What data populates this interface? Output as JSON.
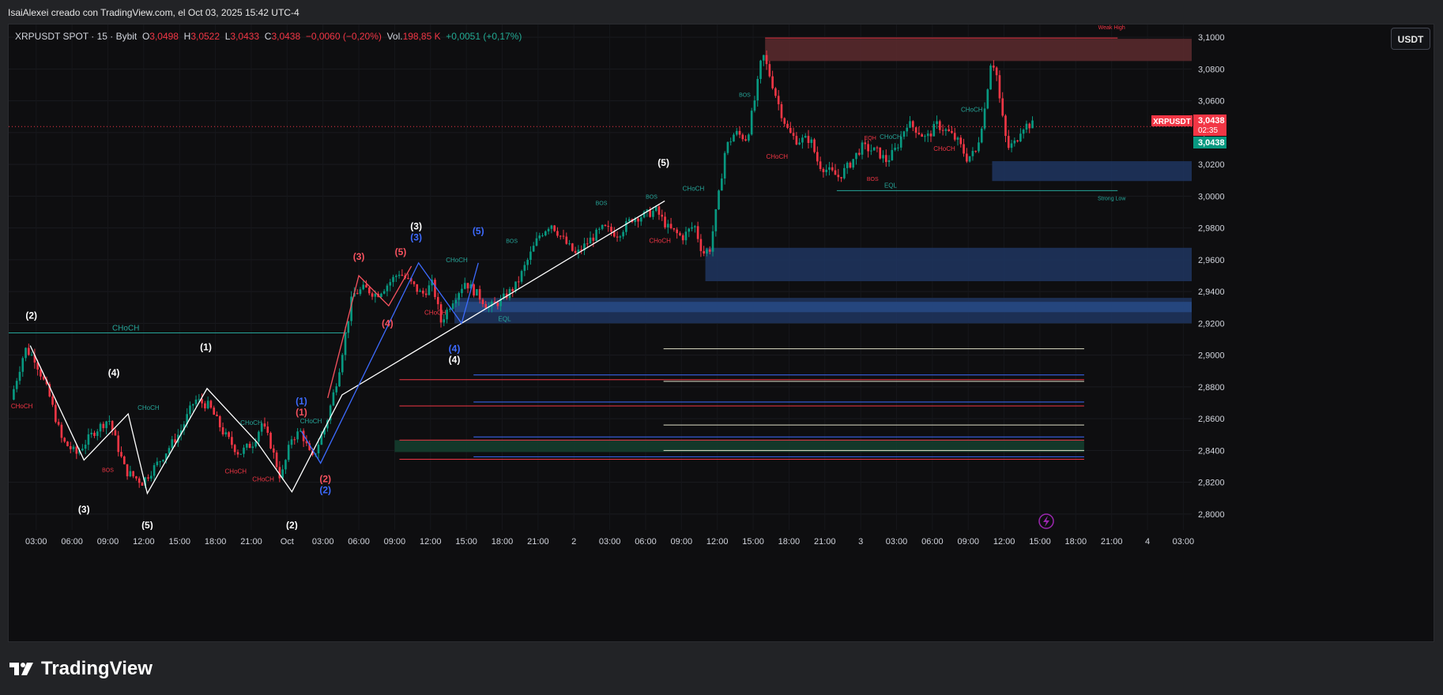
{
  "header": {
    "credit": "IsaiAlexei creado con TradingView.com, el Oct 03, 2025 15:42 UTC-4"
  },
  "legend": {
    "symbol": "XRPUSDT SPOT · 15 · Bybit",
    "o_label": "O",
    "o": "3,0498",
    "h_label": "H",
    "h": "3,0522",
    "l_label": "L",
    "l": "3,0433",
    "c_label": "C",
    "c": "3,0438",
    "change": "−0,0060 (−0,20%)",
    "vol_label": "Vol.",
    "vol": "198,85 K",
    "vol_change": "+0,0051 (+0,17%)"
  },
  "currency_button": "USDT",
  "price_tag": {
    "symbol": "XRPUSDT",
    "price": "3,0438",
    "countdown": "02:35",
    "price2": "3,0438"
  },
  "footer": {
    "brand": "TradingView"
  },
  "colors": {
    "up": "#089981",
    "down": "#f23645",
    "zone_blue": "#1e3560",
    "zone_red": "#5c2a2e",
    "zone_green": "#14402f",
    "teal": "#26a69a",
    "wave_white": "#ffffff",
    "wave_red": "#f7525f",
    "wave_blue": "#3d6bff"
  },
  "chart_data": {
    "type": "candlestick",
    "symbol": "XRPUSDT",
    "timeframe": "15",
    "ylim": [
      2.79,
      3.108
    ],
    "y_ticks": [
      "3,1000",
      "3,0800",
      "3,0600",
      "3,0400",
      "3,0200",
      "3,0000",
      "2,9800",
      "2,9600",
      "2,9400",
      "2,9200",
      "2,9000",
      "2,8800",
      "2,8600",
      "2,8400",
      "2,8200",
      "2,8000"
    ],
    "y_tick_values": [
      3.1,
      3.08,
      3.06,
      3.04,
      3.02,
      3.0,
      2.98,
      2.96,
      2.94,
      2.92,
      2.9,
      2.88,
      2.86,
      2.84,
      2.82,
      2.8
    ],
    "x_ticks": [
      "03:00",
      "06:00",
      "09:00",
      "12:00",
      "15:00",
      "18:00",
      "21:00",
      "Oct",
      "03:00",
      "06:00",
      "09:00",
      "12:00",
      "15:00",
      "18:00",
      "21:00",
      "2",
      "03:00",
      "06:00",
      "09:00",
      "12:00",
      "15:00",
      "18:00",
      "21:00",
      "3",
      "03:00",
      "06:00",
      "09:00",
      "12:00",
      "15:00",
      "18:00",
      "21:00",
      "4",
      "03:00"
    ],
    "x_tick_hours": [
      3,
      6,
      9,
      12,
      15,
      18,
      21,
      24,
      27,
      30,
      33,
      36,
      39,
      42,
      45,
      48,
      51,
      54,
      57,
      60,
      63,
      66,
      69,
      72,
      75,
      78,
      81,
      84,
      87,
      90,
      93,
      96,
      99
    ],
    "x_range_hours": [
      0.7,
      99.7
    ],
    "last_price": 3.0438,
    "price_path": [
      [
        1.0,
        2.872
      ],
      [
        2.2,
        2.904
      ],
      [
        3.0,
        2.898
      ],
      [
        4.2,
        2.875
      ],
      [
        5.3,
        2.846
      ],
      [
        6.5,
        2.838
      ],
      [
        8.0,
        2.852
      ],
      [
        9.2,
        2.86
      ],
      [
        10.6,
        2.827
      ],
      [
        12.0,
        2.82
      ],
      [
        13.5,
        2.834
      ],
      [
        15.2,
        2.852
      ],
      [
        16.4,
        2.872
      ],
      [
        17.6,
        2.868
      ],
      [
        18.8,
        2.851
      ],
      [
        20.1,
        2.838
      ],
      [
        21.3,
        2.845
      ],
      [
        22.0,
        2.857
      ],
      [
        22.7,
        2.845
      ],
      [
        23.6,
        2.822
      ],
      [
        24.5,
        2.848
      ],
      [
        25.3,
        2.852
      ],
      [
        26.2,
        2.834
      ],
      [
        27.4,
        2.857
      ],
      [
        28.4,
        2.888
      ],
      [
        29.6,
        2.938
      ],
      [
        30.6,
        2.942
      ],
      [
        31.6,
        2.938
      ],
      [
        32.6,
        2.945
      ],
      [
        33.5,
        2.952
      ],
      [
        34.5,
        2.945
      ],
      [
        35.4,
        2.938
      ],
      [
        36.3,
        2.945
      ],
      [
        37.0,
        2.921
      ],
      [
        38.0,
        2.935
      ],
      [
        39.0,
        2.946
      ],
      [
        40.2,
        2.937
      ],
      [
        41.0,
        2.93
      ],
      [
        42.0,
        2.934
      ],
      [
        43.3,
        2.944
      ],
      [
        44.4,
        2.962
      ],
      [
        45.2,
        2.975
      ],
      [
        46.2,
        2.983
      ],
      [
        47.5,
        2.97
      ],
      [
        48.3,
        2.963
      ],
      [
        49.4,
        2.972
      ],
      [
        50.6,
        2.98
      ],
      [
        51.8,
        2.976
      ],
      [
        53.0,
        2.986
      ],
      [
        54.0,
        2.988
      ],
      [
        55.0,
        2.991
      ],
      [
        56.0,
        2.98
      ],
      [
        57.2,
        2.974
      ],
      [
        58.2,
        2.982
      ],
      [
        58.9,
        2.964
      ],
      [
        59.5,
        2.967
      ],
      [
        60.2,
        2.998
      ],
      [
        60.8,
        3.03
      ],
      [
        61.6,
        3.04
      ],
      [
        62.6,
        3.036
      ],
      [
        63.4,
        3.066
      ],
      [
        63.9,
        3.09
      ],
      [
        64.6,
        3.074
      ],
      [
        65.4,
        3.054
      ],
      [
        66.1,
        3.04
      ],
      [
        66.8,
        3.035
      ],
      [
        67.9,
        3.036
      ],
      [
        68.6,
        3.02
      ],
      [
        69.4,
        3.016
      ],
      [
        70.3,
        3.012
      ],
      [
        71.2,
        3.02
      ],
      [
        72.2,
        3.031
      ],
      [
        73.5,
        3.028
      ],
      [
        74.3,
        3.022
      ],
      [
        75.1,
        3.03
      ],
      [
        76.0,
        3.046
      ],
      [
        76.8,
        3.042
      ],
      [
        77.6,
        3.036
      ],
      [
        78.5,
        3.045
      ],
      [
        79.5,
        3.04
      ],
      [
        80.3,
        3.034
      ],
      [
        81.0,
        3.024
      ],
      [
        81.8,
        3.028
      ],
      [
        82.5,
        3.055
      ],
      [
        83.0,
        3.084
      ],
      [
        83.4,
        3.082
      ],
      [
        83.8,
        3.058
      ],
      [
        84.4,
        3.03
      ],
      [
        85.1,
        3.034
      ],
      [
        85.6,
        3.044
      ],
      [
        86.3,
        3.045
      ]
    ],
    "zones": [
      {
        "type": "supply",
        "from_hour": 64,
        "to_hour": 99.7,
        "top": 3.099,
        "bottom": 3.085
      },
      {
        "type": "demand",
        "from_hour": 83,
        "to_hour": 99.7,
        "top": 3.022,
        "bottom": 3.0095
      },
      {
        "type": "demand",
        "from_hour": 59,
        "to_hour": 99.7,
        "top": 2.9675,
        "bottom": 2.9465
      },
      {
        "type": "demand",
        "from_hour": 38,
        "to_hour": 99.7,
        "top": 2.936,
        "bottom": 2.92
      },
      {
        "type": "demand_inner",
        "from_hour": 38,
        "to_hour": 99.7,
        "top": 2.9335,
        "bottom": 2.927
      },
      {
        "type": "green",
        "from_hour": 33,
        "to_hour": 90.7,
        "top": 2.8465,
        "bottom": 2.839
      }
    ],
    "fib_levels": [
      {
        "from_hour": 55.5,
        "to_hour": 90.7,
        "value": 2.904,
        "color": "#e0e0c8"
      },
      {
        "from_hour": 39.6,
        "to_hour": 90.7,
        "value": 2.8875,
        "color": "#3d6bff"
      },
      {
        "from_hour": 33.4,
        "to_hour": 90.7,
        "value": 2.8845,
        "color": "#f23645"
      },
      {
        "from_hour": 55.5,
        "to_hour": 90.7,
        "value": 2.8835,
        "color": "#e0e0c8"
      },
      {
        "from_hour": 39.6,
        "to_hour": 90.7,
        "value": 2.8705,
        "color": "#3d6bff"
      },
      {
        "from_hour": 33.4,
        "to_hour": 90.7,
        "value": 2.868,
        "color": "#f23645"
      },
      {
        "from_hour": 55.5,
        "to_hour": 90.7,
        "value": 2.856,
        "color": "#e0e0c8"
      },
      {
        "from_hour": 39.6,
        "to_hour": 90.7,
        "value": 2.8485,
        "color": "#3d6bff"
      },
      {
        "from_hour": 33.4,
        "to_hour": 90.7,
        "value": 2.8465,
        "color": "#f23645"
      },
      {
        "from_hour": 55.5,
        "to_hour": 90.7,
        "value": 2.84,
        "color": "#e0e0c8"
      },
      {
        "from_hour": 39.6,
        "to_hour": 90.7,
        "value": 2.836,
        "color": "#3d6bff"
      },
      {
        "from_hour": 33.4,
        "to_hour": 90.7,
        "value": 2.8345,
        "color": "#f23645"
      }
    ],
    "hlines": [
      {
        "from_hour": 0.7,
        "to_hour": 29.0,
        "value": 2.914,
        "color": "#26a69a",
        "style": "solid"
      },
      {
        "from_hour": 70.0,
        "to_hour": 93.5,
        "value": 3.0035,
        "color": "#26a69a",
        "style": "solid"
      },
      {
        "from_hour": 64.0,
        "to_hour": 93.5,
        "value": 3.0995,
        "color": "#f23645",
        "style": "solid"
      },
      {
        "from_hour": 0.7,
        "to_hour": 99.7,
        "value": 3.0438,
        "color": "#f23645",
        "style": "dotted"
      }
    ],
    "waves": [
      {
        "color": "#ffffff",
        "points": [
          [
            2.5,
            2.906
          ],
          [
            7.0,
            2.834
          ],
          [
            10.7,
            2.863
          ],
          [
            12.3,
            2.813
          ],
          [
            17.3,
            2.879
          ],
          [
            21.5,
            2.845
          ],
          [
            24.4,
            2.814
          ],
          [
            28.6,
            2.875
          ],
          [
            38.6,
            2.92
          ]
        ]
      },
      {
        "color": "#ffffff",
        "points": [
          [
            38.6,
            2.92
          ],
          [
            55.6,
            2.997
          ]
        ]
      },
      {
        "color": "#f7525f",
        "points": [
          [
            27.4,
            2.873
          ],
          [
            30.0,
            2.95
          ],
          [
            32.5,
            2.931
          ],
          [
            34.4,
            2.956
          ]
        ]
      },
      {
        "color": "#3d6bff",
        "points": [
          [
            25.2,
            2.852
          ],
          [
            26.8,
            2.832
          ],
          [
            35.0,
            2.958
          ],
          [
            38.6,
            2.92
          ],
          [
            40.0,
            2.958
          ]
        ]
      }
    ],
    "wave_labels": [
      {
        "text": "(2)",
        "hour": 2.6,
        "value": 2.923,
        "color": "#ffffff"
      },
      {
        "text": "(4)",
        "hour": 9.5,
        "value": 2.887,
        "color": "#ffffff"
      },
      {
        "text": "(1)",
        "hour": 17.2,
        "value": 2.903,
        "color": "#ffffff"
      },
      {
        "text": "(3)",
        "hour": 7.0,
        "value": 2.801,
        "color": "#ffffff"
      },
      {
        "text": "(5)",
        "hour": 12.3,
        "value": 2.791,
        "color": "#ffffff"
      },
      {
        "text": "(2)",
        "hour": 24.4,
        "value": 2.791,
        "color": "#ffffff"
      },
      {
        "text": "(1)",
        "hour": 25.2,
        "value": 2.869,
        "color": "#3d6bff"
      },
      {
        "text": "(1)",
        "hour": 25.2,
        "value": 2.862,
        "color": "#f7525f"
      },
      {
        "text": "(2)",
        "hour": 27.2,
        "value": 2.82,
        "color": "#f7525f"
      },
      {
        "text": "(2)",
        "hour": 27.2,
        "value": 2.813,
        "color": "#3d6bff"
      },
      {
        "text": "(3)",
        "hour": 30.0,
        "value": 2.96,
        "color": "#f7525f"
      },
      {
        "text": "(4)",
        "hour": 32.4,
        "value": 2.918,
        "color": "#f7525f"
      },
      {
        "text": "(5)",
        "hour": 33.5,
        "value": 2.963,
        "color": "#f7525f"
      },
      {
        "text": "(3)",
        "hour": 34.8,
        "value": 2.979,
        "color": "#ffffff"
      },
      {
        "text": "(3)",
        "hour": 34.8,
        "value": 2.972,
        "color": "#3d6bff"
      },
      {
        "text": "(5)",
        "hour": 40.0,
        "value": 2.976,
        "color": "#3d6bff"
      },
      {
        "text": "(4)",
        "hour": 38.0,
        "value": 2.902,
        "color": "#3d6bff"
      },
      {
        "text": "(4)",
        "hour": 38.0,
        "value": 2.895,
        "color": "#ffffff"
      },
      {
        "text": "(5)",
        "hour": 55.5,
        "value": 3.019,
        "color": "#ffffff"
      }
    ],
    "smc_labels": [
      {
        "text": "CHoCH",
        "hour": 10.5,
        "value": 2.9155,
        "color": "#26a69a",
        "size": 10
      },
      {
        "text": "CHoCH",
        "hour": 1.8,
        "value": 2.8665,
        "color": "#f23645",
        "size": 8
      },
      {
        "text": "CHoCH",
        "hour": 12.4,
        "value": 2.8655,
        "color": "#26a69a",
        "size": 8
      },
      {
        "text": "BOS",
        "hour": 9.0,
        "value": 2.8265,
        "color": "#f23645",
        "size": 7
      },
      {
        "text": "CHoCH",
        "hour": 19.7,
        "value": 2.8255,
        "color": "#f23645",
        "size": 8
      },
      {
        "text": "CHoCH",
        "hour": 21.0,
        "value": 2.856,
        "color": "#26a69a",
        "size": 8
      },
      {
        "text": "CHoCH",
        "hour": 22.0,
        "value": 2.8205,
        "color": "#f23645",
        "size": 8
      },
      {
        "text": "CHoCH",
        "hour": 26.0,
        "value": 2.857,
        "color": "#26a69a",
        "size": 8
      },
      {
        "text": "CHoCH",
        "hour": 38.2,
        "value": 2.9585,
        "color": "#26a69a",
        "size": 8
      },
      {
        "text": "CHoCH",
        "hour": 36.4,
        "value": 2.9255,
        "color": "#f23645",
        "size": 8
      },
      {
        "text": "BOS",
        "hour": 42.8,
        "value": 2.9705,
        "color": "#26a69a",
        "size": 7
      },
      {
        "text": "EQL",
        "hour": 42.2,
        "value": 2.9215,
        "color": "#26a69a",
        "size": 8
      },
      {
        "text": "BOS",
        "hour": 50.3,
        "value": 2.9945,
        "color": "#26a69a",
        "size": 7
      },
      {
        "text": "BOS",
        "hour": 54.5,
        "value": 2.9985,
        "color": "#26a69a",
        "size": 7
      },
      {
        "text": "CHoCH",
        "hour": 58.0,
        "value": 3.0035,
        "color": "#26a69a",
        "size": 8
      },
      {
        "text": "CHoCH",
        "hour": 55.2,
        "value": 2.9705,
        "color": "#f23645",
        "size": 8
      },
      {
        "text": "BOS",
        "hour": 62.3,
        "value": 3.0625,
        "color": "#26a69a",
        "size": 7
      },
      {
        "text": "CHoCH",
        "hour": 65.0,
        "value": 3.0235,
        "color": "#f23645",
        "size": 8
      },
      {
        "text": "Weak High",
        "hour": 93.0,
        "value": 3.105,
        "color": "#f23645",
        "size": 7
      },
      {
        "text": "Strong Low",
        "hour": 93.0,
        "value": 2.9975,
        "color": "#26a69a",
        "size": 7
      },
      {
        "text": "EQH",
        "hour": 72.8,
        "value": 3.0355,
        "color": "#f23645",
        "size": 7
      },
      {
        "text": "CHoCH",
        "hour": 74.5,
        "value": 3.036,
        "color": "#26a69a",
        "size": 8
      },
      {
        "text": "BOS",
        "hour": 73.0,
        "value": 3.0095,
        "color": "#f23645",
        "size": 7
      },
      {
        "text": "EQL",
        "hour": 74.5,
        "value": 3.0055,
        "color": "#26a69a",
        "size": 8
      },
      {
        "text": "CHoCH",
        "hour": 81.3,
        "value": 3.053,
        "color": "#26a69a",
        "size": 8
      },
      {
        "text": "CHoCH",
        "hour": 79.0,
        "value": 3.0285,
        "color": "#f23645",
        "size": 8
      }
    ]
  }
}
